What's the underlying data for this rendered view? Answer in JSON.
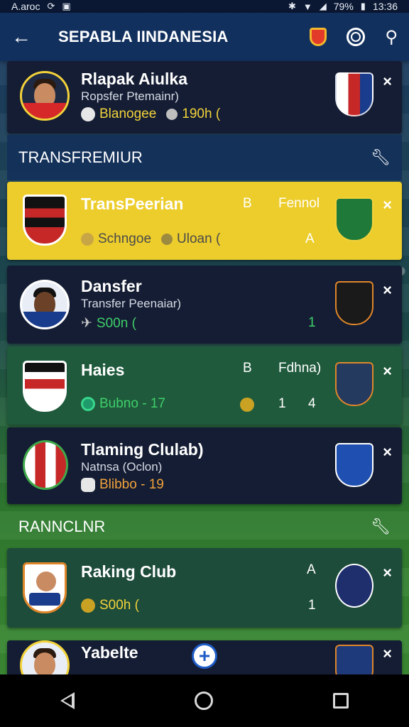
{
  "status_bar": {
    "left_text": "A.aroc",
    "right_text": "79%",
    "time": "13:36"
  },
  "app_bar": {
    "title": "SEPABLA IINDANESIA"
  },
  "sections": [
    {
      "label": "TRANSFREMIUR"
    },
    {
      "label": "RANNCLNR"
    }
  ],
  "cards": [
    {
      "name": "Rlapak Aiulka",
      "sub": "Ropsfer Ptemainr)",
      "meta1": "Blanogee",
      "meta2": "190h (",
      "col_a": "",
      "col_b": "",
      "num": ""
    },
    {
      "name": "TransPeerian",
      "sub": "",
      "meta1": "Schngoe",
      "meta2": "Uloan (",
      "col_a": "B",
      "col_b": "Fennol",
      "num": "A"
    },
    {
      "name": "Dansfer",
      "sub": "Transfer Peenaiar)",
      "meta1": "S00n (",
      "meta2": "",
      "col_a": "",
      "col_b": "",
      "num": "1"
    },
    {
      "name": "Haies",
      "sub": "",
      "meta1": "Bubno - 17",
      "meta2": "",
      "col_a": "B",
      "col_b": "Fdhna)",
      "num": "1",
      "num2": "4"
    },
    {
      "name": "Tlaming Clulab)",
      "sub": "Natnsa (Oclon)",
      "meta1": "Blibbo - 19",
      "meta2": "",
      "col_a": "",
      "col_b": "",
      "num": ""
    },
    {
      "name": "Raking Club",
      "sub": "",
      "meta1": "S00h (",
      "meta2": "",
      "col_a": "A",
      "col_b": "",
      "num": "1"
    },
    {
      "name": "Yabelte",
      "sub": "",
      "meta1": "",
      "meta2": "",
      "col_a": "",
      "col_b": "",
      "num": ""
    }
  ],
  "close_glyph": "×",
  "colors": {
    "app_bar": "#12305e",
    "yellow_card": "#edcd2c",
    "green_text": "#3fd06a",
    "yellow_text": "#f2d23b"
  }
}
